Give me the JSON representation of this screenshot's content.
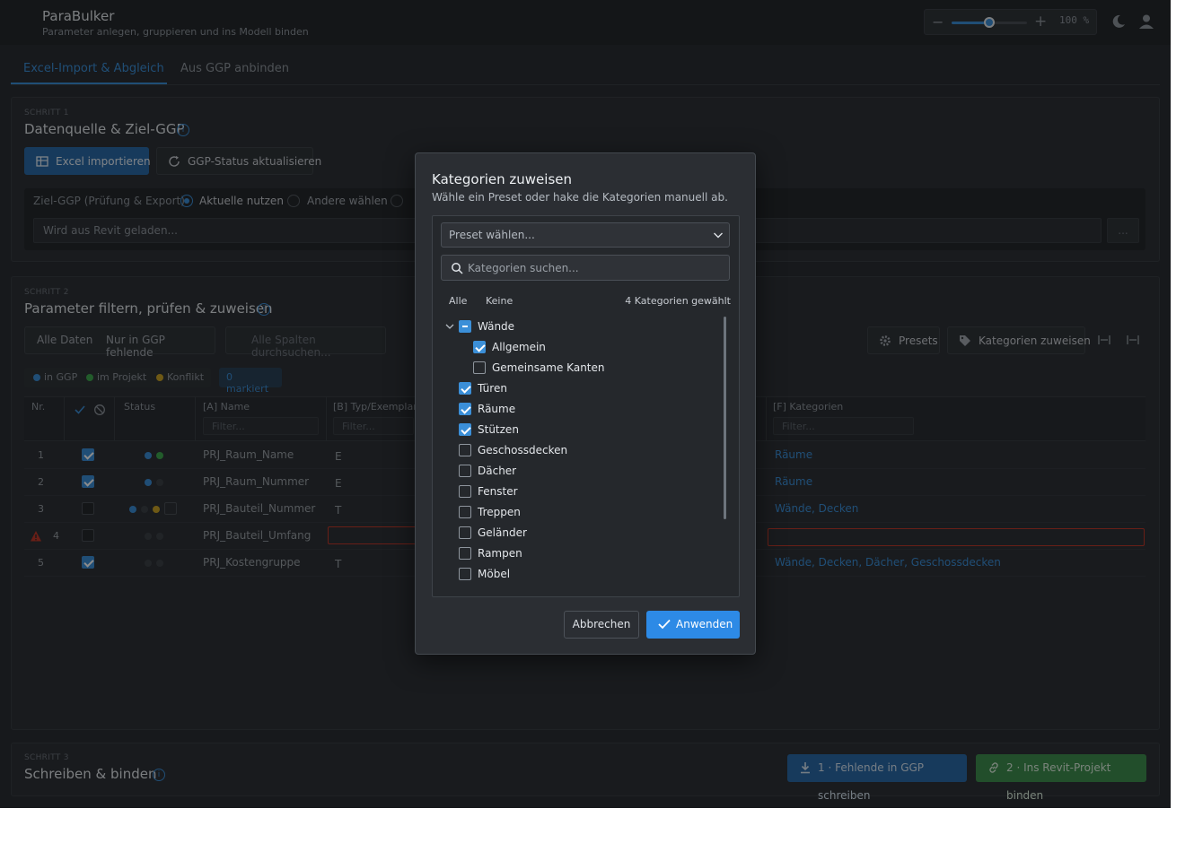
{
  "header": {
    "title": "ParaBulker",
    "subtitle": "Parameter anlegen, gruppieren und ins Modell binden",
    "zoom_value": "100 %",
    "zoom_fraction": 0.5
  },
  "tabs": [
    {
      "label": "Excel-Import & Abgleich",
      "active": true
    },
    {
      "label": "Aus GGP anbinden",
      "active": false
    }
  ],
  "step1": {
    "label": "SCHRITT 1",
    "title": "Datenquelle & Ziel-GGP",
    "excel_button": "Excel importieren",
    "refresh_button": "GGP-Status aktualisieren",
    "ggp_label": "Ziel-GGP (Prüfung & Export)",
    "radio_current": "Aktuelle nutzen",
    "radio_other": "Andere wählen",
    "ggp_path": "Wird aus Revit geladen...",
    "more_button": "..."
  },
  "step2": {
    "label": "SCHRITT 2",
    "title": "Parameter filtern, prüfen & zuweisen",
    "filter_all": "Alle Daten",
    "filter_missing": "Nur in GGP fehlende",
    "search_placeholder": "Alle Spalten durchsuchen...",
    "presets_button": "Presets",
    "assign_button": "Kategorien zuweisen",
    "legend": {
      "in_ggp": "in GGP",
      "in_project": "im Projekt",
      "conflict": "Konflikt"
    },
    "marked": "0 markiert",
    "columns": {
      "nr": "Nr.",
      "status": "Status",
      "name": "[A] Name",
      "type": "[B] Typ/Exemplar",
      "categories": "[F] Kategorien",
      "filter_placeholder": "Filter..."
    },
    "rows": [
      {
        "nr": "1",
        "checked": true,
        "name": "PRJ_Raum_Name",
        "type": "E",
        "categories": "Räume"
      },
      {
        "nr": "2",
        "checked": true,
        "name": "PRJ_Raum_Nummer",
        "type": "E",
        "categories": "Räume"
      },
      {
        "nr": "3",
        "checked": false,
        "name": "PRJ_Bauteil_Nummer",
        "type": "T",
        "categories": "Wände, Decken"
      },
      {
        "nr": "4",
        "checked": false,
        "name": "PRJ_Bauteil_Umfang",
        "type": "",
        "categories": ""
      },
      {
        "nr": "5",
        "checked": true,
        "name": "PRJ_Kostengruppe",
        "type": "T",
        "categories": "Wände, Decken, Dächer, Geschossdecken"
      }
    ]
  },
  "step3": {
    "label": "SCHRITT 3",
    "title": "Schreiben & binden",
    "write_button": "1 · Fehlende in GGP schreiben",
    "bind_button": "2 · Ins Revit-Projekt binden"
  },
  "dialog": {
    "title": "Kategorien zuweisen",
    "subtitle": "Wähle ein Preset oder hake die Kategorien manuell ab.",
    "preset_placeholder": "Preset wählen...",
    "search_placeholder": "Kategorien suchen...",
    "select_all": "Alle",
    "select_none": "Keine",
    "count_text": "4 Kategorien gewählt",
    "categories": [
      {
        "label": "Wände",
        "state": "partial",
        "level": 0
      },
      {
        "label": "Allgemein",
        "state": "checked",
        "level": 1
      },
      {
        "label": "Gemeinsame Kanten",
        "state": "unchecked",
        "level": 1
      },
      {
        "label": "Türen",
        "state": "checked",
        "level": 0
      },
      {
        "label": "Räume",
        "state": "checked",
        "level": 0
      },
      {
        "label": "Stützen",
        "state": "checked",
        "level": 0
      },
      {
        "label": "Geschossdecken",
        "state": "unchecked",
        "level": 0
      },
      {
        "label": "Dächer",
        "state": "unchecked",
        "level": 0
      },
      {
        "label": "Fenster",
        "state": "unchecked",
        "level": 0
      },
      {
        "label": "Treppen",
        "state": "unchecked",
        "level": 0
      },
      {
        "label": "Geländer",
        "state": "unchecked",
        "level": 0
      },
      {
        "label": "Rampen",
        "state": "unchecked",
        "level": 0
      },
      {
        "label": "Möbel",
        "state": "unchecked",
        "level": 0
      }
    ],
    "cancel_button": "Abbrechen",
    "apply_button": "Anwenden"
  },
  "colors": {
    "accent": "#3b8fd8",
    "in_ggp": "#3b8fd8",
    "in_project": "#3fa84f",
    "conflict": "#c9a227",
    "error": "#c0392b"
  }
}
